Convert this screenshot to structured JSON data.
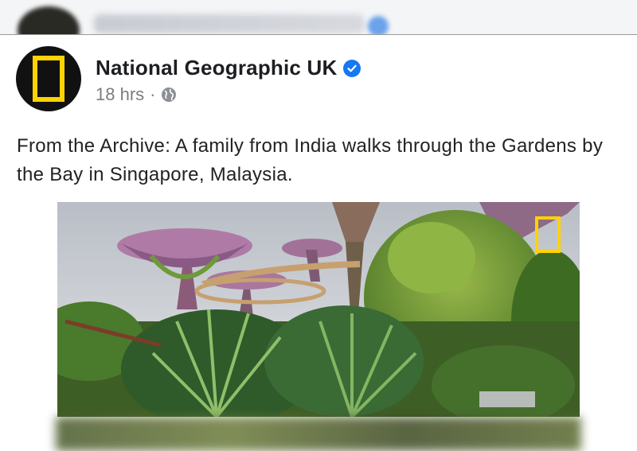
{
  "post": {
    "page_name": "National Geographic UK",
    "verified": true,
    "timestamp": "18 hrs",
    "separator": "·",
    "audience_icon": "globe-icon",
    "text": "From the Archive: A family from India walks through the Gardens by the Bay in Singapore, Malaysia."
  },
  "photo": {
    "subject": "Supertree Grove, Gardens by the Bay",
    "logo_icon": "natgeo-yellow-frame"
  },
  "colors": {
    "brand_yellow": "#ffd200",
    "verified_blue": "#1877f2",
    "meta_gray": "#7a7d82"
  }
}
